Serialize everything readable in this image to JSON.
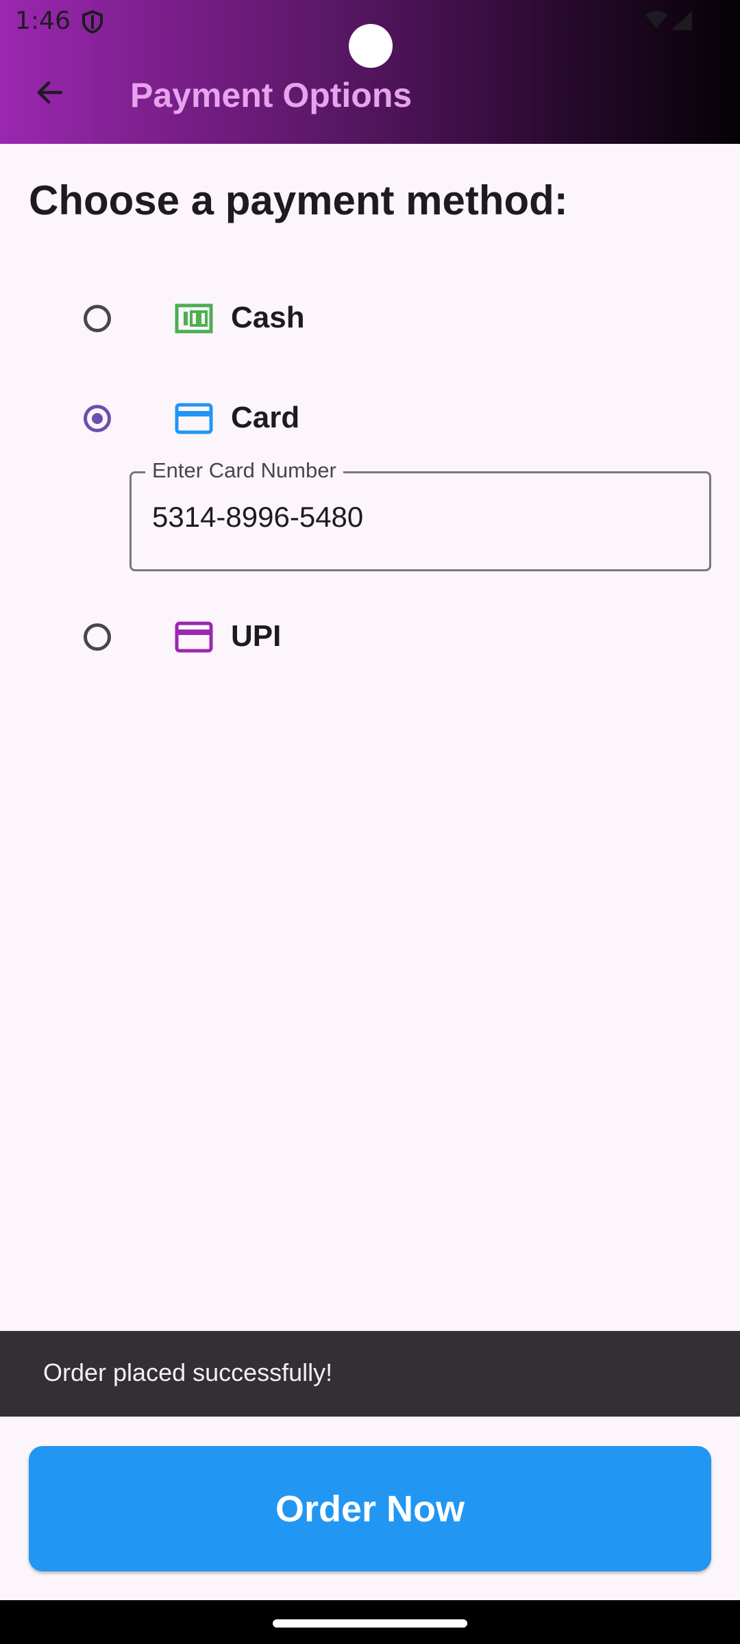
{
  "status_bar": {
    "time": "1:46",
    "icons": [
      "shield-icon",
      "wifi-icon",
      "signal-icon"
    ]
  },
  "app_bar": {
    "title": "Payment Options",
    "back_icon": "arrow-back-icon",
    "gradient": [
      "#9b27b0",
      "#000000"
    ],
    "title_color": "#e8a3ee"
  },
  "main": {
    "heading": "Choose a payment method:",
    "options": [
      {
        "label": "Cash",
        "icon": "money-icon",
        "icon_color": "#4caf50",
        "selected": false
      },
      {
        "label": "Card",
        "icon": "credit-card-icon",
        "icon_color": "#2196f3",
        "selected": true
      },
      {
        "label": "UPI",
        "icon": "credit-card-icon",
        "icon_color": "#9c27b0",
        "selected": false
      }
    ],
    "card_field": {
      "label": "Enter Card Number",
      "value": "5314-8996-5480"
    }
  },
  "snackbar": {
    "message": "Order placed successfully!"
  },
  "order_button": {
    "label": "Order Now",
    "color": "#2196f3"
  }
}
